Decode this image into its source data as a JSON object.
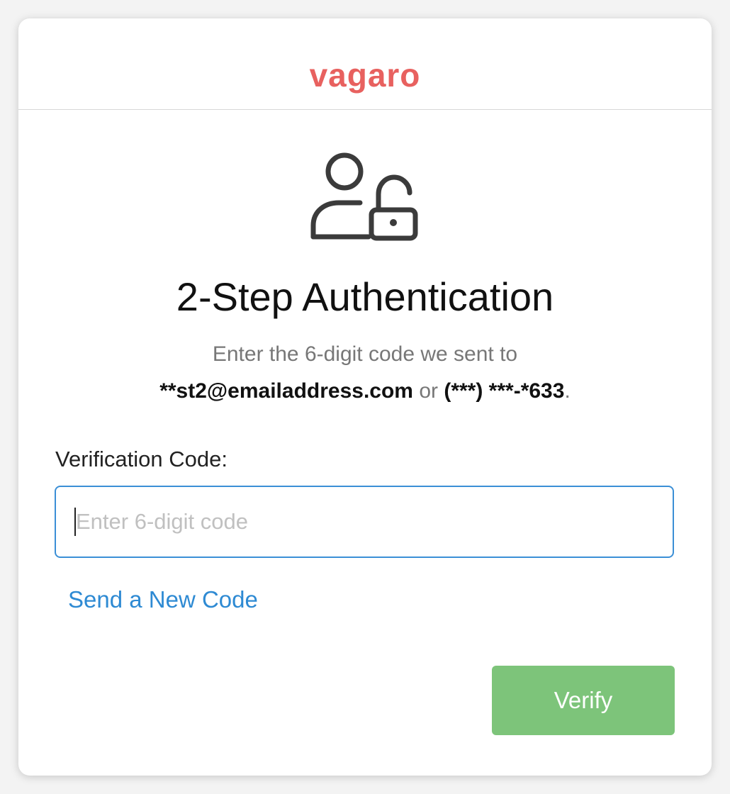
{
  "brand": {
    "logo_text": "vagaro",
    "logo_color": "#e8615f"
  },
  "auth": {
    "icon": "user-lock-icon",
    "title": "2-Step Authentication",
    "subtitle_line1": "Enter the 6-digit code we sent to",
    "email": "**st2@emailaddress.com",
    "or_text": "or",
    "phone": "(***) ***-*633",
    "period": "."
  },
  "form": {
    "label": "Verification Code:",
    "placeholder": "Enter 6-digit code",
    "value": "",
    "send_new_code": "Send a New Code",
    "link_color": "#2e8ad3",
    "verify_label": "Verify",
    "verify_color": "#7dc47a"
  }
}
